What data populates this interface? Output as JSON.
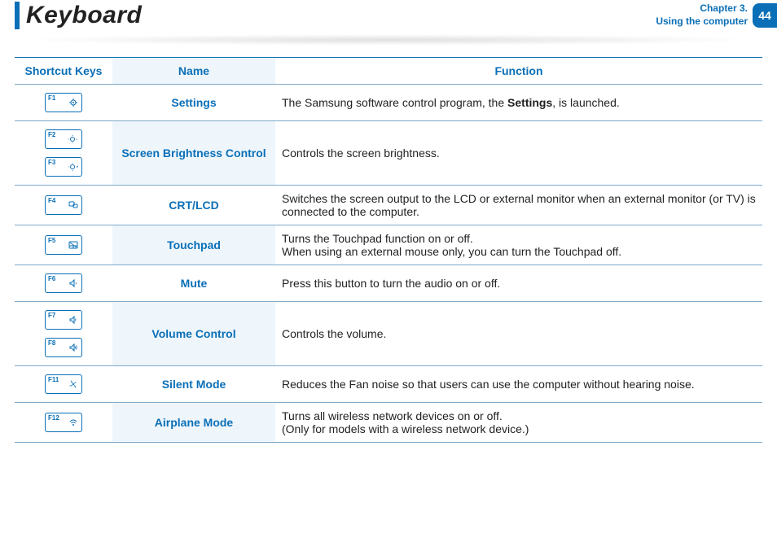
{
  "header": {
    "title": "Keyboard",
    "chapter_line1": "Chapter 3.",
    "chapter_line2": "Using the computer",
    "page_number": "44"
  },
  "table": {
    "headers": {
      "keys": "Shortcut Keys",
      "name": "Name",
      "func": "Function"
    },
    "rows": [
      {
        "keys": [
          {
            "label": "F1",
            "glyph": "gear"
          }
        ],
        "name": "Settings",
        "func_prefix": "The Samsung software control program, the ",
        "func_bold": "Settings",
        "func_suffix": ", is launched."
      },
      {
        "keys": [
          {
            "label": "F2",
            "glyph": "bright-down"
          },
          {
            "label": "F3",
            "glyph": "bright-up"
          }
        ],
        "name": "Screen Brightness Control",
        "func": "Controls the screen brightness."
      },
      {
        "keys": [
          {
            "label": "F4",
            "glyph": "display"
          }
        ],
        "name": "CRT/LCD",
        "func": "Switches the screen output to the LCD or external monitor when an external monitor (or TV) is connected to the computer."
      },
      {
        "keys": [
          {
            "label": "F5",
            "glyph": "touchpad"
          }
        ],
        "name": "Touchpad",
        "func_line1": "Turns the Touchpad function on or off.",
        "func_line2": "When using an external mouse only, you can turn the Touchpad off."
      },
      {
        "keys": [
          {
            "label": "F6",
            "glyph": "mute"
          }
        ],
        "name": "Mute",
        "func": "Press this button to turn the audio on or off."
      },
      {
        "keys": [
          {
            "label": "F7",
            "glyph": "vol-down"
          },
          {
            "label": "F8",
            "glyph": "vol-up"
          }
        ],
        "name": "Volume Control",
        "func": "Controls the volume."
      },
      {
        "keys": [
          {
            "label": "F11",
            "glyph": "fan"
          }
        ],
        "name": "Silent Mode",
        "func": "Reduces the Fan noise so that users can use the computer without hearing noise."
      },
      {
        "keys": [
          {
            "label": "F12",
            "glyph": "wifi"
          }
        ],
        "name": "Airplane Mode",
        "func_line1": "Turns all wireless network devices on or off.",
        "func_line2": "(Only for models with a wireless network device.)"
      }
    ]
  }
}
